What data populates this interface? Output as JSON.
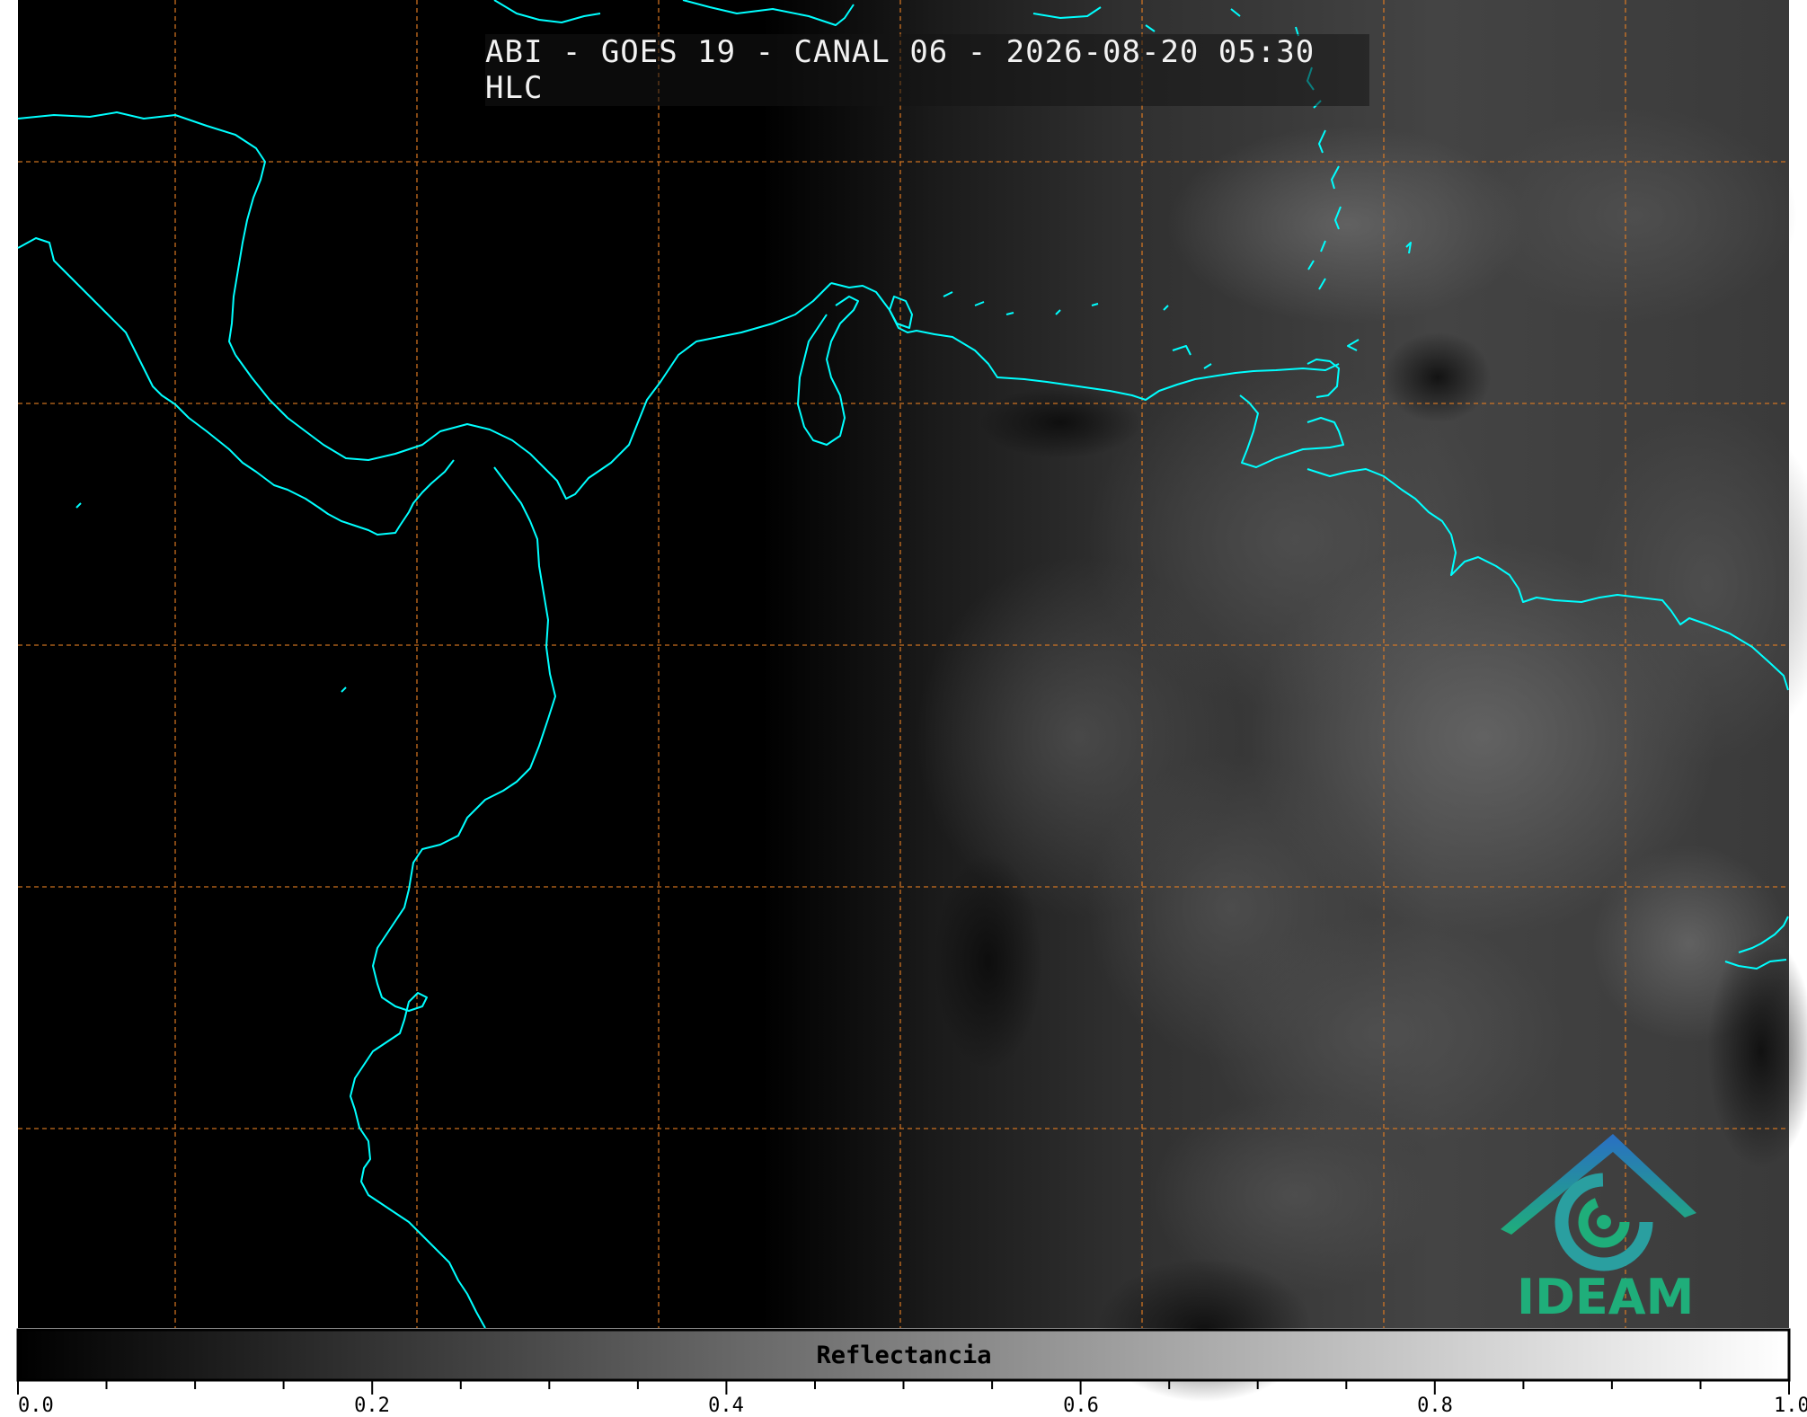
{
  "title": "ABI - GOES 19 - CANAL 06 - 2026-08-20 05:30 HLC",
  "colorbar": {
    "label": "Reflectancia",
    "ticks": [
      "0.0",
      "0.2",
      "0.4",
      "0.6",
      "0.8",
      "1.0"
    ],
    "range": [
      0.0,
      1.0
    ]
  },
  "logo": {
    "text": "IDEAM"
  },
  "colors": {
    "coastline": "#00ffff",
    "gridline": "#e07b22",
    "logo_green": "#1fae7a",
    "logo_blue": "#2a6fc4"
  }
}
